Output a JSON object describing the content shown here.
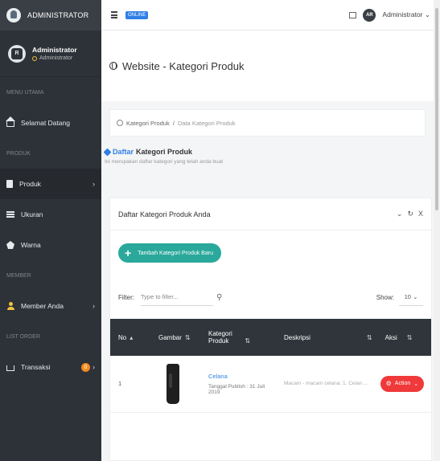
{
  "sidebar": {
    "brand": "ADMINISTRATOR",
    "user": {
      "name": "Administrator",
      "role": "Administrator"
    },
    "sections": {
      "menu_utama": "MENU UTAMA",
      "produk": "PRODUK",
      "member": "MEMBER",
      "list_order": "LIST ORDER"
    },
    "items": {
      "selamat_datang": "Selamat Datang",
      "produk": "Produk",
      "ukuran": "Ukuran",
      "warna": "Warna",
      "member_anda": "Member Anda",
      "transaksi": "Transaksi"
    },
    "transaksi_badge": "0",
    "caret": "›"
  },
  "topbar": {
    "status_badge": "ONLINE",
    "user_label": "Administrator",
    "dropdown_caret": "⌄",
    "avatar_text": "AR"
  },
  "page": {
    "title": "Website - Kategori Produk",
    "breadcrumb": {
      "root": "Kategori Produk",
      "separator": "/",
      "current": "Data Kategori Produk"
    },
    "content_title_accent": "Daftar",
    "content_title_rest": "Kategori Produk",
    "content_subtitle": "Ini merupakan daftar kategori yang telah anda buat"
  },
  "card": {
    "title": "Daftar Kategori Produk Anda",
    "tools": {
      "collapse": "⌄",
      "refresh": "↻",
      "close": "X"
    },
    "add_button": "Tambah Kategori Produk Baru",
    "filter_label": "Filter:",
    "filter_placeholder": "Type to filter...",
    "show_label": "Show:",
    "show_value": "10"
  },
  "table": {
    "headers": {
      "no": "No",
      "gambar": "Gambar",
      "kategori": "Kategori Produk",
      "deskripsi": "Deskripsi",
      "aksi": "Aksi"
    },
    "rows": [
      {
        "no": "1",
        "name": "Celana",
        "date": "Tanggal Publish : 31 Juli 2019",
        "desc": "Macam - macam celana: 1. Celan ...",
        "action": "Action"
      }
    ]
  }
}
